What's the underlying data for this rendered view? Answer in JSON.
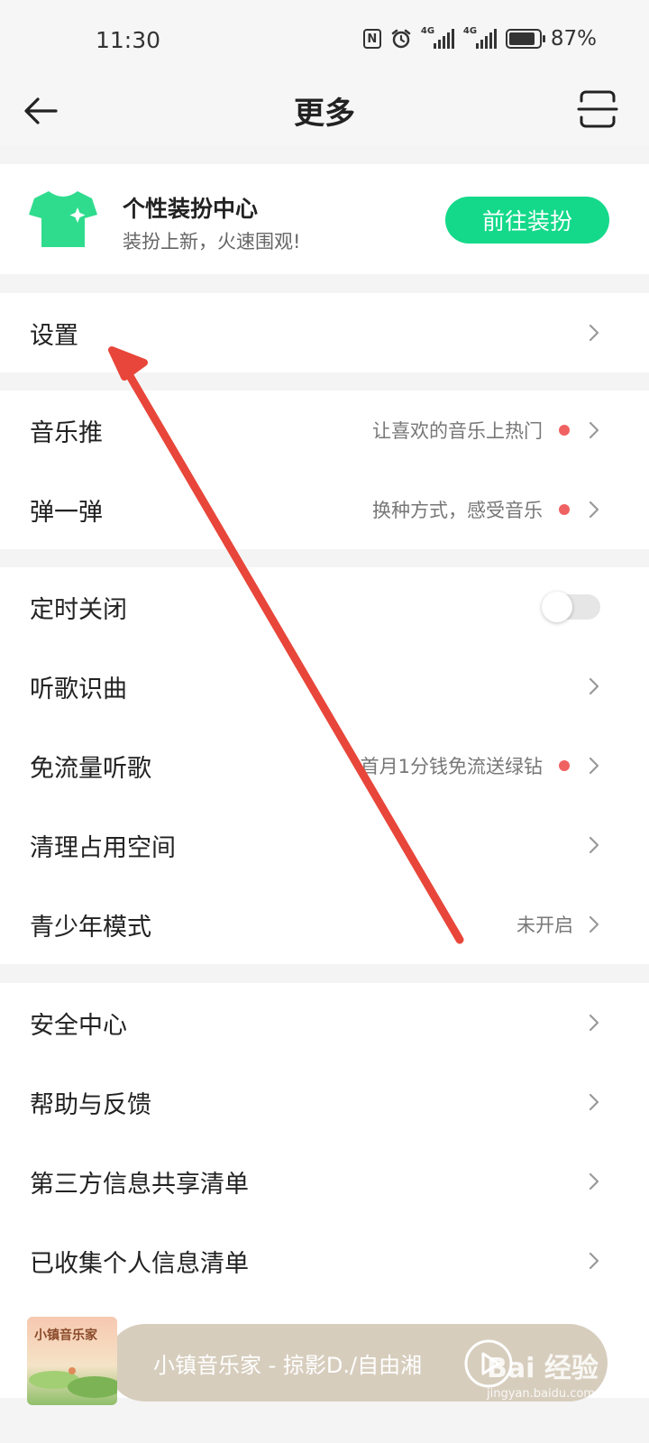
{
  "status_bar": {
    "time": "11:30",
    "network_1": "4G",
    "network_2": "4G",
    "battery_percent": 87,
    "battery_text": "87%",
    "icons": [
      "nfc-icon",
      "alarm-icon",
      "signal-icon",
      "signal-icon",
      "battery-icon"
    ]
  },
  "header": {
    "title": "更多",
    "back_icon": "back-arrow-icon",
    "scan_icon": "scan-icon"
  },
  "skin_card": {
    "title": "个性装扮中心",
    "subtitle": "装扮上新，火速围观!",
    "button_label": "前往装扮",
    "icon": "tshirt-icon",
    "accent": "#14d98a"
  },
  "settings": {
    "label": "设置"
  },
  "group2": [
    {
      "label": "音乐推",
      "hint": "让喜欢的音乐上热门",
      "red_dot": true
    },
    {
      "label": "弹一弹",
      "hint": "换种方式，感受音乐",
      "red_dot": true
    }
  ],
  "group3": [
    {
      "label": "定时关闭",
      "toggle": false
    },
    {
      "label": "听歌识曲"
    },
    {
      "label": "免流量听歌",
      "hint": "首月1分钱免流送绿钻",
      "red_dot": true
    },
    {
      "label": "清理占用空间"
    },
    {
      "label": "青少年模式",
      "hint": "未开启"
    }
  ],
  "group4": [
    {
      "label": "安全中心"
    },
    {
      "label": "帮助与反馈"
    },
    {
      "label": "第三方信息共享清单"
    },
    {
      "label": "已收集个人信息清单"
    }
  ],
  "player": {
    "title": "小镇音乐家 - 掠影D./自由湘",
    "album_title": "小镇音乐家",
    "play_icon": "play-icon"
  },
  "watermark": {
    "logo": "Bai 经验",
    "url": "jingyan.baidu.com"
  },
  "colors": {
    "red_dot": "#f06262",
    "annotation_arrow": "#e8463a"
  }
}
